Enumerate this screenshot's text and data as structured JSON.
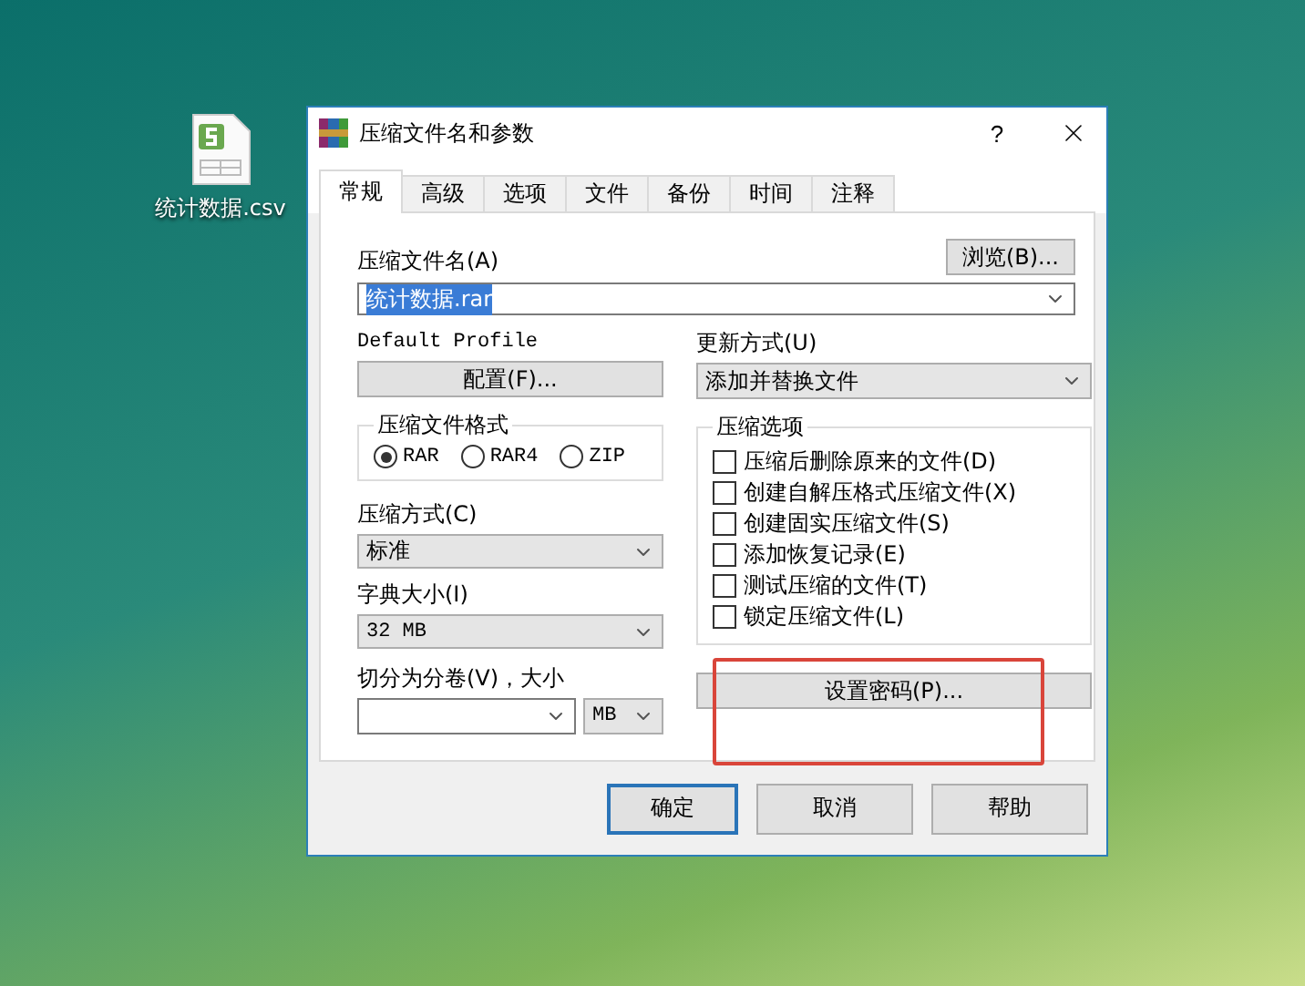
{
  "desktop_icon": {
    "label": "统计数据.csv"
  },
  "window": {
    "title": "压缩文件名和参数",
    "help": "?"
  },
  "tabs": [
    {
      "label": "常规",
      "selected": true
    },
    {
      "label": "高级",
      "selected": false
    },
    {
      "label": "选项",
      "selected": false
    },
    {
      "label": "文件",
      "selected": false
    },
    {
      "label": "备份",
      "selected": false
    },
    {
      "label": "时间",
      "selected": false
    },
    {
      "label": "注释",
      "selected": false
    }
  ],
  "archive_name": {
    "label": "压缩文件名(A)",
    "value": "统计数据.rar",
    "text_selected": true,
    "browse": "浏览(B)..."
  },
  "profile": {
    "label": "Default Profile",
    "button": "配置(F)..."
  },
  "update_mode": {
    "label": "更新方式(U)",
    "value": "添加并替换文件"
  },
  "format": {
    "legend": "压缩文件格式",
    "options": [
      {
        "label": "RAR",
        "selected": true
      },
      {
        "label": "RAR4",
        "selected": false
      },
      {
        "label": "ZIP",
        "selected": false
      }
    ]
  },
  "method": {
    "label": "压缩方式(C)",
    "value": "标准"
  },
  "dictionary": {
    "label": "字典大小(I)",
    "value": "32 MB"
  },
  "split": {
    "label": "切分为分卷(V)，大小",
    "unit": "MB"
  },
  "options": {
    "legend": "压缩选项",
    "items": [
      {
        "label": "压缩后删除原来的文件(D)",
        "checked": false
      },
      {
        "label": "创建自解压格式压缩文件(X)",
        "checked": false
      },
      {
        "label": "创建固实压缩文件(S)",
        "checked": false
      },
      {
        "label": "添加恢复记录(E)",
        "checked": false
      },
      {
        "label": "测试压缩的文件(T)",
        "checked": false
      },
      {
        "label": "锁定压缩文件(L)",
        "checked": false
      }
    ]
  },
  "password_button": "设置密码(P)...",
  "buttons": [
    {
      "label": "确定",
      "default": true
    },
    {
      "label": "取消",
      "default": false
    },
    {
      "label": "帮助",
      "default": false
    }
  ]
}
